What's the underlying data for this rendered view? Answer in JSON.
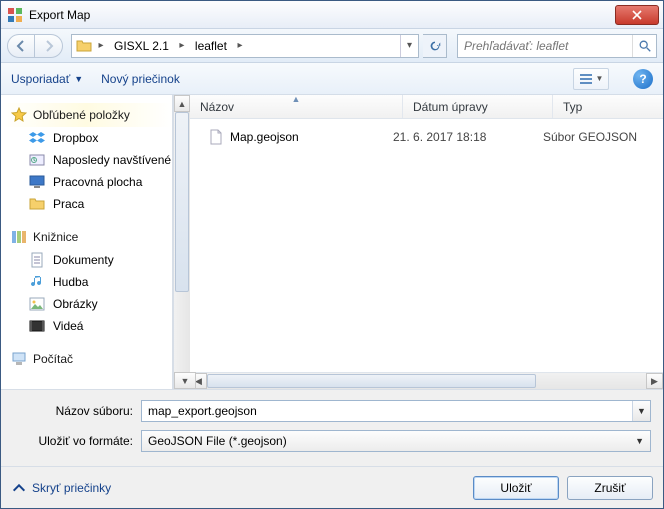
{
  "window": {
    "title": "Export Map"
  },
  "nav": {
    "path_segments": [
      "GISXL 2.1",
      "leaflet"
    ]
  },
  "search": {
    "placeholder": "Prehľadávať: leaflet"
  },
  "toolbar": {
    "organize": "Usporiadať",
    "newfolder": "Nový priečinok"
  },
  "columns": {
    "name": "Názov",
    "date": "Dátum úpravy",
    "type": "Typ"
  },
  "sidebar": {
    "groups": [
      {
        "id": "favorites",
        "label": "Obľúbené položky",
        "icon": "star",
        "items": [
          {
            "label": "Dropbox",
            "icon": "dropbox"
          },
          {
            "label": "Naposledy navštívené",
            "icon": "recent"
          },
          {
            "label": "Pracovná plocha",
            "icon": "desktop"
          },
          {
            "label": "Praca",
            "icon": "folder"
          }
        ]
      },
      {
        "id": "libraries",
        "label": "Knižnice",
        "icon": "libraries",
        "items": [
          {
            "label": "Dokumenty",
            "icon": "doc"
          },
          {
            "label": "Hudba",
            "icon": "music"
          },
          {
            "label": "Obrázky",
            "icon": "image"
          },
          {
            "label": "Videá",
            "icon": "video"
          }
        ]
      },
      {
        "id": "computer",
        "label": "Počítač",
        "icon": "computer",
        "items": []
      }
    ]
  },
  "files": [
    {
      "name": "Map.geojson",
      "date": "21. 6. 2017 18:18",
      "type": "Súbor GEOJSON"
    }
  ],
  "form": {
    "filename_label": "Názov súboru:",
    "filename_value": "map_export.geojson",
    "format_label": "Uložiť vo formáte:",
    "format_value": "GeoJSON File (*.geojson)"
  },
  "bottom": {
    "hide_folders": "Skryť priečinky",
    "save": "Uložiť",
    "cancel": "Zrušiť"
  }
}
